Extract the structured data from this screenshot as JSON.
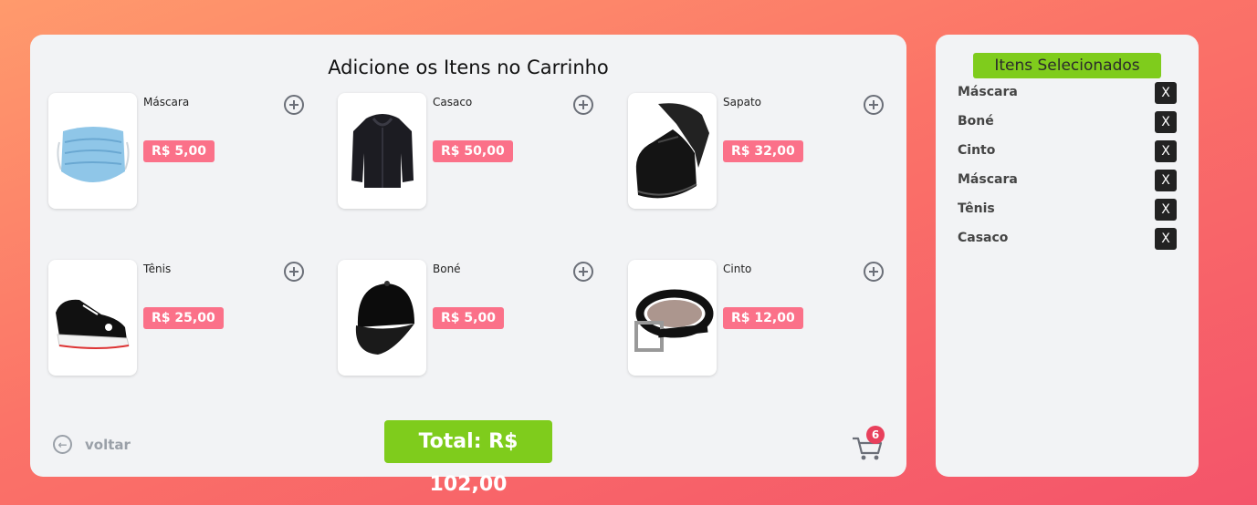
{
  "main": {
    "title": "Adicione os Itens no Carrinho",
    "products": [
      {
        "name": "Máscara",
        "price": "R$ 5,00",
        "icon": "mask-image"
      },
      {
        "name": "Casaco",
        "price": "R$ 50,00",
        "icon": "jacket-image"
      },
      {
        "name": "Sapato",
        "price": "R$ 32,00",
        "icon": "shoe-image"
      },
      {
        "name": "Tênis",
        "price": "R$ 25,00",
        "icon": "sneaker-image"
      },
      {
        "name": "Boné",
        "price": "R$ 5,00",
        "icon": "cap-image"
      },
      {
        "name": "Cinto",
        "price": "R$ 12,00",
        "icon": "belt-image"
      }
    ],
    "back_label": "voltar",
    "total_label": "Total: R$ 102,00",
    "cart_count": "6",
    "colors": {
      "price_badge": "#fb7189",
      "total_bg": "#7fcc1c",
      "cart_badge": "#e8405c"
    }
  },
  "side": {
    "title": "Itens Selecionados",
    "remove_label": "X",
    "items": [
      "Máscara",
      "Boné",
      "Cinto",
      "Máscara",
      "Tênis",
      "Casaco"
    ]
  }
}
